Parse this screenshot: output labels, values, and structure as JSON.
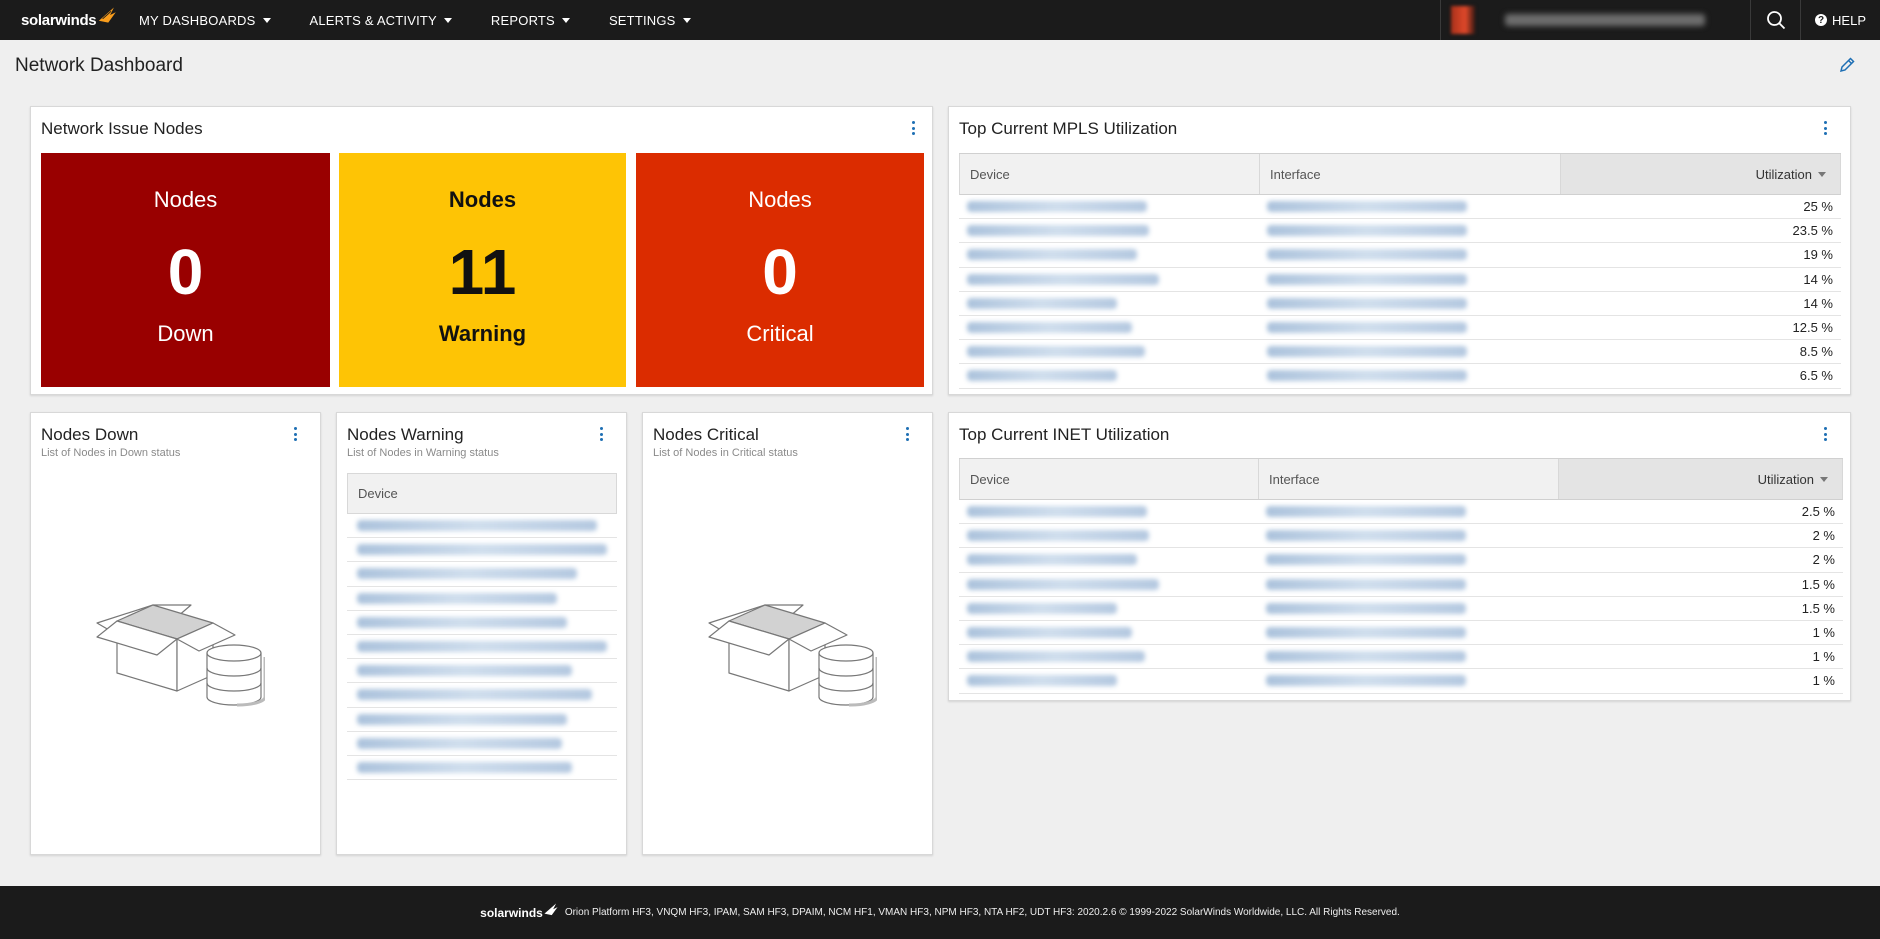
{
  "app": {
    "logo_text": "solarwinds",
    "nav": [
      {
        "label": "MY DASHBOARDS"
      },
      {
        "label": "ALERTS & ACTIVITY"
      },
      {
        "label": "REPORTS"
      },
      {
        "label": "SETTINGS"
      }
    ],
    "help_label": "HELP"
  },
  "page": {
    "title": "Network Dashboard"
  },
  "issue_nodes": {
    "title": "Network Issue Nodes",
    "tiles": [
      {
        "top": "Nodes",
        "count": "0",
        "bottom": "Down",
        "bg": "#990000",
        "fg": "#ffffff"
      },
      {
        "top": "Nodes",
        "count": "11",
        "bottom": "Warning",
        "bg": "#fec405",
        "fg": "#111111"
      },
      {
        "top": "Nodes",
        "count": "0",
        "bottom": "Critical",
        "bg": "#db2c00",
        "fg": "#ffffff"
      }
    ]
  },
  "mpls": {
    "title": "Top Current MPLS Utilization",
    "columns": {
      "device": "Device",
      "interface": "Interface",
      "utilization": "Utilization"
    },
    "rows": [
      {
        "utilization": "25 %"
      },
      {
        "utilization": "23.5 %"
      },
      {
        "utilization": "19 %"
      },
      {
        "utilization": "14 %"
      },
      {
        "utilization": "14 %"
      },
      {
        "utilization": "12.5 %"
      },
      {
        "utilization": "8.5 %"
      },
      {
        "utilization": "6.5 %"
      }
    ]
  },
  "inet": {
    "title": "Top Current INET Utilization",
    "columns": {
      "device": "Device",
      "interface": "Interface",
      "utilization": "Utilization"
    },
    "rows": [
      {
        "utilization": "2.5 %"
      },
      {
        "utilization": "2 %"
      },
      {
        "utilization": "2 %"
      },
      {
        "utilization": "1.5 %"
      },
      {
        "utilization": "1.5 %"
      },
      {
        "utilization": "1 %"
      },
      {
        "utilization": "1 %"
      },
      {
        "utilization": "1 %"
      }
    ]
  },
  "nodes_down": {
    "title": "Nodes Down",
    "subtitle": "List of Nodes in Down status"
  },
  "nodes_warning": {
    "title": "Nodes Warning",
    "subtitle": "List of Nodes in Warning status",
    "column": "Device",
    "row_count": 11
  },
  "nodes_critical": {
    "title": "Nodes Critical",
    "subtitle": "List of Nodes in Critical status"
  },
  "footer": {
    "logo_text": "solarwinds",
    "text": "Orion Platform HF3, VNQM HF3, IPAM, SAM HF3, DPAIM, NCM HF1, VMAN HF3, NPM HF3, NTA HF2, UDT HF3: 2020.2.6 © 1999-2022 SolarWinds Worldwide, LLC. All Rights Reserved."
  },
  "colors": {
    "accent": "#1e6fb4",
    "nav_bg": "#1b1b1b",
    "logo_orange": "#f99d1c"
  }
}
